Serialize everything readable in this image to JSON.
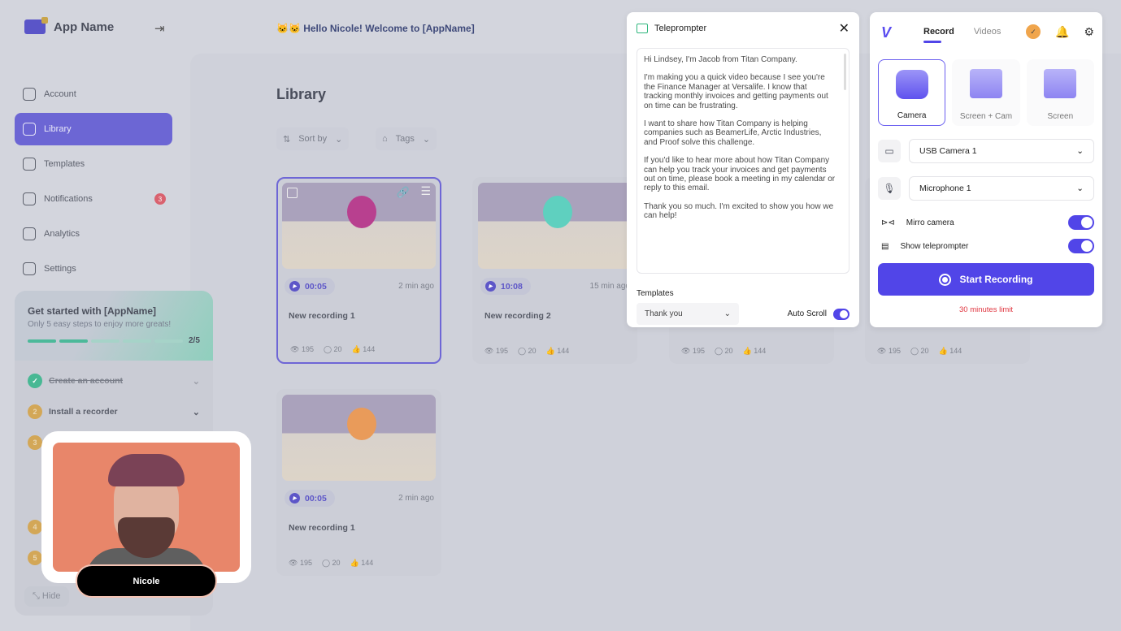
{
  "app": {
    "name": "App Name",
    "greeting": "Hello Nicole! Welcome to [AppName]"
  },
  "sidebar": {
    "items": [
      {
        "label": "Account",
        "icon": "user-icon"
      },
      {
        "label": "Library",
        "icon": "library-icon",
        "active": true
      },
      {
        "label": "Templates",
        "icon": "templates-icon"
      },
      {
        "label": "Notifications",
        "icon": "bell-icon",
        "badge": "3"
      },
      {
        "label": "Analytics",
        "icon": "chart-icon"
      },
      {
        "label": "Settings",
        "icon": "gear-icon"
      }
    ]
  },
  "get_started": {
    "title": "Get started with [AppName]",
    "subtitle": "Only 5 easy steps to enjoy more greats!",
    "progress": "2/5",
    "completed": 2,
    "total": 5,
    "steps": [
      {
        "num": "1",
        "label": "Create an account",
        "done": true
      },
      {
        "num": "2",
        "label": "Install a recorder"
      },
      {
        "num": "3"
      },
      {
        "num": "4"
      },
      {
        "num": "5"
      }
    ],
    "hide_label": "Hide"
  },
  "camera_preview": {
    "name": "Nicole"
  },
  "library": {
    "title": "Library",
    "sort_label": "Sort by",
    "tags_label": "Tags",
    "cards": [
      {
        "duration": "00:05",
        "ago": "2 min ago",
        "title": "New recording 1",
        "views": "195",
        "comments": "20",
        "likes": "144"
      },
      {
        "duration": "10:08",
        "ago": "15 min ago",
        "title": "New recording 2",
        "views": "195",
        "comments": "20",
        "likes": "144"
      },
      {
        "views": "195",
        "comments": "20",
        "likes": "144"
      },
      {
        "views": "195",
        "comments": "20",
        "likes": "144"
      },
      {
        "duration": "00:05",
        "ago": "2 min ago",
        "title": "New recording 1",
        "views": "195",
        "comments": "20",
        "likes": "144"
      }
    ]
  },
  "teleprompter": {
    "title": "Teleprompter",
    "script": [
      "Hi Lindsey, I'm Jacob from Titan Company.",
      "I'm making you a quick video because I see you're the Finance Manager at Versalife. I know that tracking monthly invoices and getting payments out on time can be frustrating.",
      "I want to share how Titan Company is helping companies such as BeamerLife, Arctic Industries, and Proof solve this challenge.",
      "If you'd like to hear more about how Titan Company can help you track your invoices and get payments out on time, please book a meeting in my calendar or reply to this email.",
      "Thank you so much. I'm excited to show you how we can help!"
    ],
    "templates_label": "Templates",
    "template_value": "Thank you",
    "auto_scroll_label": "Auto Scroll",
    "auto_scroll": true
  },
  "recorder": {
    "tabs": [
      "Record",
      "Videos"
    ],
    "modes": [
      "Camera",
      "Screen + Cam",
      "Screen"
    ],
    "selected_mode": "Camera",
    "camera": "USB Camera 1",
    "microphone": "Microphone 1",
    "mirror_label": "Mirro camera",
    "mirror": true,
    "teleprompter_label": "Show teleprompter",
    "teleprompter": true,
    "start_label": "Start Recording",
    "limit": "30 minutes limit",
    "accent": "#5145e8",
    "limit_color": "#e0353f"
  }
}
